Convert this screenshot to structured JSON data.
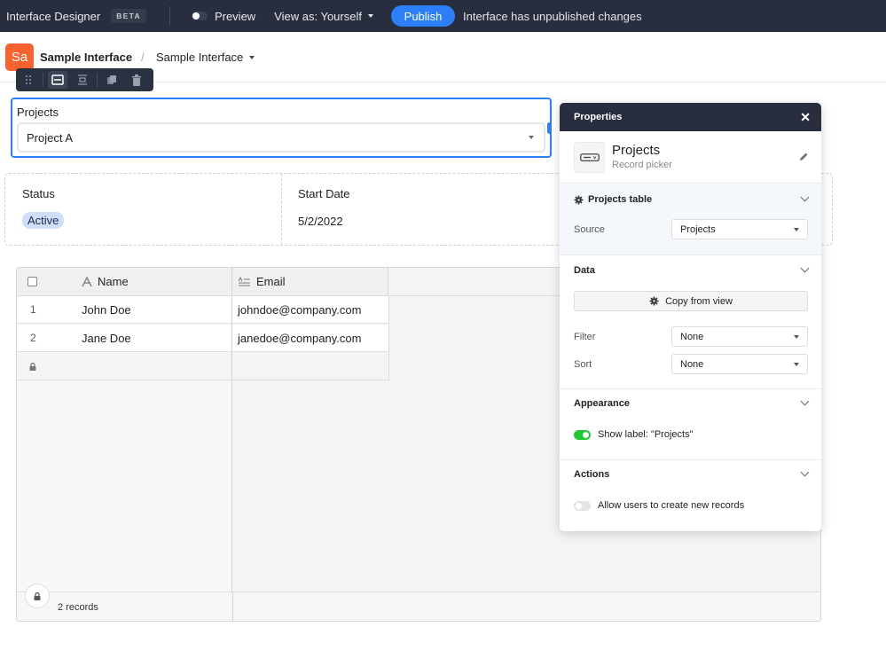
{
  "topbar": {
    "app_title": "Interface Designer",
    "beta_badge": "BETA",
    "preview_label": "Preview",
    "preview_enabled": false,
    "view_as_label": "View as: Yourself",
    "publish_label": "Publish",
    "status_text": "Interface has unpublished changes",
    "colors": {
      "background": "#282e3d",
      "publish": "#2d7ff9"
    }
  },
  "header": {
    "logo_text": "Sa",
    "logo_color": "#f8622f",
    "breadcrumb": [
      "Sample Interface",
      "Sample Interface"
    ],
    "separator": "/"
  },
  "element_toolbar": {
    "items": [
      {
        "icon": "drag-handle-icon",
        "active": false
      },
      {
        "icon": "full-width-icon",
        "active": true
      },
      {
        "icon": "fit-width-icon",
        "active": false
      },
      {
        "icon": "duplicate-icon",
        "active": false
      },
      {
        "icon": "trash-icon",
        "active": false
      }
    ]
  },
  "record_picker": {
    "label": "Projects",
    "selected_value": "Project A"
  },
  "details": {
    "fields": [
      {
        "label": "Status",
        "value": "Active",
        "type": "badge",
        "color": "#cfdffb"
      },
      {
        "label": "Start Date",
        "value": "5/2/2022",
        "type": "text"
      }
    ]
  },
  "grid": {
    "columns": [
      {
        "name": "Name",
        "icon": "text-field-icon"
      },
      {
        "name": "Email",
        "icon": "long-text-field-icon"
      }
    ],
    "rows": [
      {
        "num": "1",
        "name": "John Doe",
        "email": "johndoe@company.com"
      },
      {
        "num": "2",
        "name": "Jane Doe",
        "email": "janedoe@company.com"
      }
    ],
    "record_count": "2 records"
  },
  "properties": {
    "title": "Properties",
    "element_name": "Projects",
    "element_type": "Record picker",
    "sections": {
      "source": {
        "title": "Projects table",
        "source_label": "Source",
        "source_value": "Projects"
      },
      "data": {
        "title": "Data",
        "copy_button": "Copy from view",
        "filter_label": "Filter",
        "filter_value": "None",
        "sort_label": "Sort",
        "sort_value": "None"
      },
      "appearance": {
        "title": "Appearance",
        "show_label_text": "Show label: \"Projects\"",
        "show_label_enabled": true
      },
      "actions": {
        "title": "Actions",
        "allow_create_text": "Allow users to create new records",
        "allow_create_enabled": false
      }
    }
  }
}
